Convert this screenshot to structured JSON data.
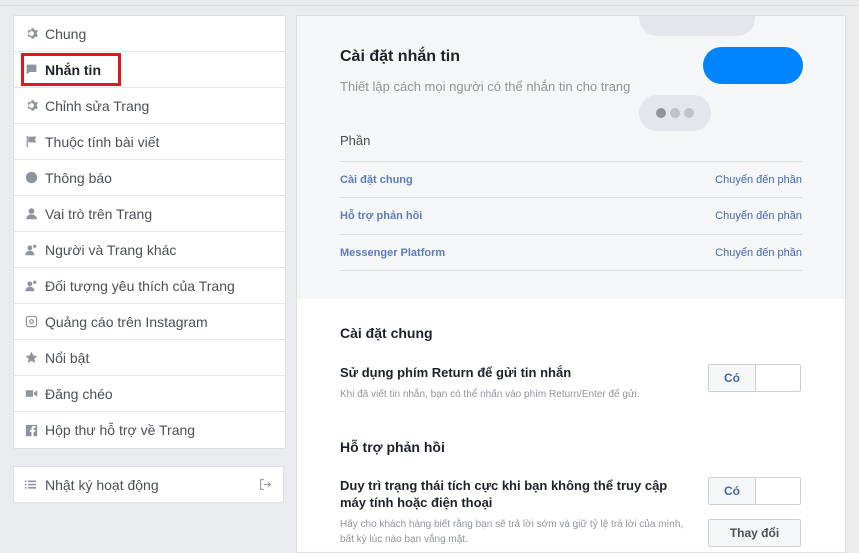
{
  "sidebar": {
    "items": [
      {
        "label": "Chung",
        "icon": "gear-icon"
      },
      {
        "label": "Nhắn tin",
        "icon": "message-icon",
        "active": true
      },
      {
        "label": "Chỉnh sửa Trang",
        "icon": "gear-icon"
      },
      {
        "label": "Thuộc tính bài viết",
        "icon": "flag-icon"
      },
      {
        "label": "Thông báo",
        "icon": "globe-icon"
      },
      {
        "label": "Vai trò trên Trang",
        "icon": "person-icon"
      },
      {
        "label": "Người và Trang khác",
        "icon": "people-icon"
      },
      {
        "label": "Đối tượng yêu thích của Trang",
        "icon": "people-icon"
      },
      {
        "label": "Quảng cáo trên Instagram",
        "icon": "instagram-icon"
      },
      {
        "label": "Nổi bật",
        "icon": "star-icon"
      },
      {
        "label": "Đăng chéo",
        "icon": "video-icon"
      },
      {
        "label": "Hộp thư hỗ trợ về Trang",
        "icon": "facebook-icon"
      }
    ],
    "activity_log": {
      "label": "Nhật ký hoạt động",
      "icon": "list-icon"
    }
  },
  "intro": {
    "title": "Cài đặt nhắn tin",
    "description": "Thiết lập cách mọi người có thể nhắn tin cho trang",
    "sections_title": "Phần",
    "sections": [
      {
        "name": "Cài đặt chung",
        "link": "Chuyển đến phần"
      },
      {
        "name": "Hỗ trợ phản hồi",
        "link": "Chuyển đến phần"
      },
      {
        "name": "Messenger Platform",
        "link": "Chuyển đến phần"
      }
    ]
  },
  "general": {
    "heading": "Cài đặt chung",
    "return_key": {
      "title": "Sử dụng phím Return để gửi tin nhắn",
      "description": "Khi đã viết tin nhắn, bạn có thể nhấn vào phím Return/Enter để gửi.",
      "toggle_label": "Có"
    }
  },
  "response": {
    "heading": "Hỗ trợ phản hồi",
    "stay_active": {
      "title": "Duy trì trạng thái tích cực khi bạn không thể truy cập máy tính hoặc điện thoại",
      "toggle_label": "Có",
      "description": "Hãy cho khách hàng biết rằng bạn sẽ trả lời sớm và giữ tỷ lệ trả lời của mình, bất kỳ lúc nào bạn vắng mặt.",
      "change_button": "Thay đổi"
    }
  },
  "colors": {
    "accent": "#4267b2",
    "messenger_blue": "#0084ff",
    "highlight": "#e0171f"
  }
}
